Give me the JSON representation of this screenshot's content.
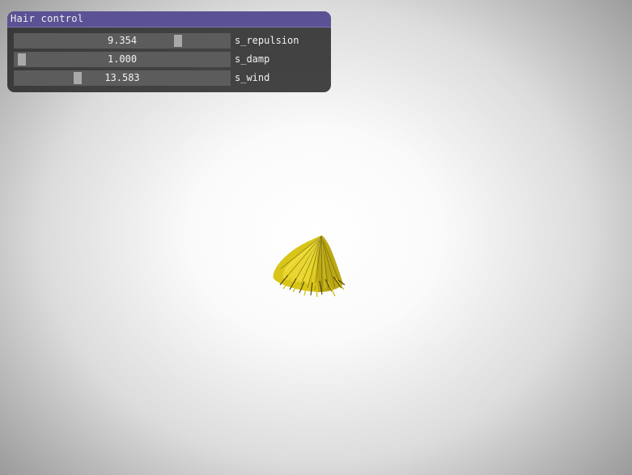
{
  "window": {
    "title": "Hair control"
  },
  "sliders": [
    {
      "label": "s_repulsion",
      "value": "9.354",
      "fraction": 0.76
    },
    {
      "label": "s_damp",
      "value": "1.000",
      "fraction": 0.0
    },
    {
      "label": "s_wind",
      "value": "13.583",
      "fraction": 0.27
    }
  ],
  "colors": {
    "title_bar": "#5a5294",
    "hair": "#e0cd1c"
  }
}
